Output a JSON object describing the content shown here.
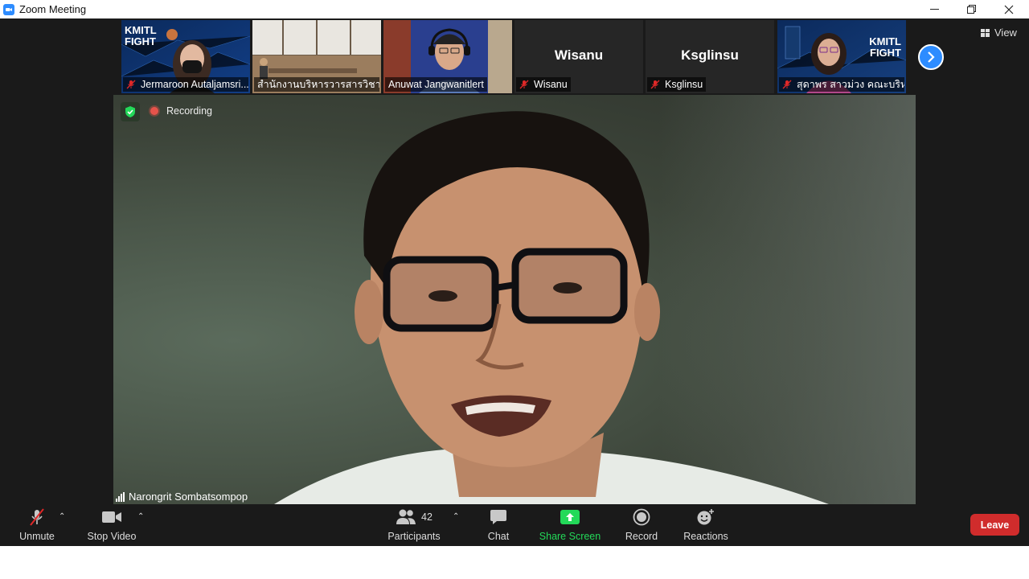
{
  "window": {
    "title": "Zoom Meeting"
  },
  "thumbnails": [
    {
      "name": "Jermaroon Autaljamsri...",
      "muted": true,
      "banner": "KMITL FIGHT"
    },
    {
      "name": "สำนักงานบริหารวารสารวิชาการ",
      "muted": false
    },
    {
      "name": "Anuwat Jangwanitlert",
      "muted": false
    },
    {
      "name": "Wisanu",
      "muted": true,
      "big_name": "Wisanu"
    },
    {
      "name": "Ksglinsu",
      "muted": true,
      "big_name": "Ksglinsu"
    },
    {
      "name": "สุดาพร สาวม่วง คณะบริหา...",
      "muted": true,
      "banner": "KMITL FIGHT"
    }
  ],
  "view_button": "View",
  "recording_label": "Recording",
  "active_speaker": "Narongrit Sombatsompop",
  "toolbar": {
    "unmute": "Unmute",
    "stop_video": "Stop Video",
    "participants": "Participants",
    "participants_count": "42",
    "chat": "Chat",
    "share_screen": "Share Screen",
    "record": "Record",
    "reactions": "Reactions",
    "leave": "Leave"
  },
  "colors": {
    "zoom_blue": "#2d8cff",
    "share_green": "#23d959",
    "leave_red": "#d02c2c",
    "muted_red": "#e02828",
    "toolbar_bg": "#1a1a1a"
  }
}
